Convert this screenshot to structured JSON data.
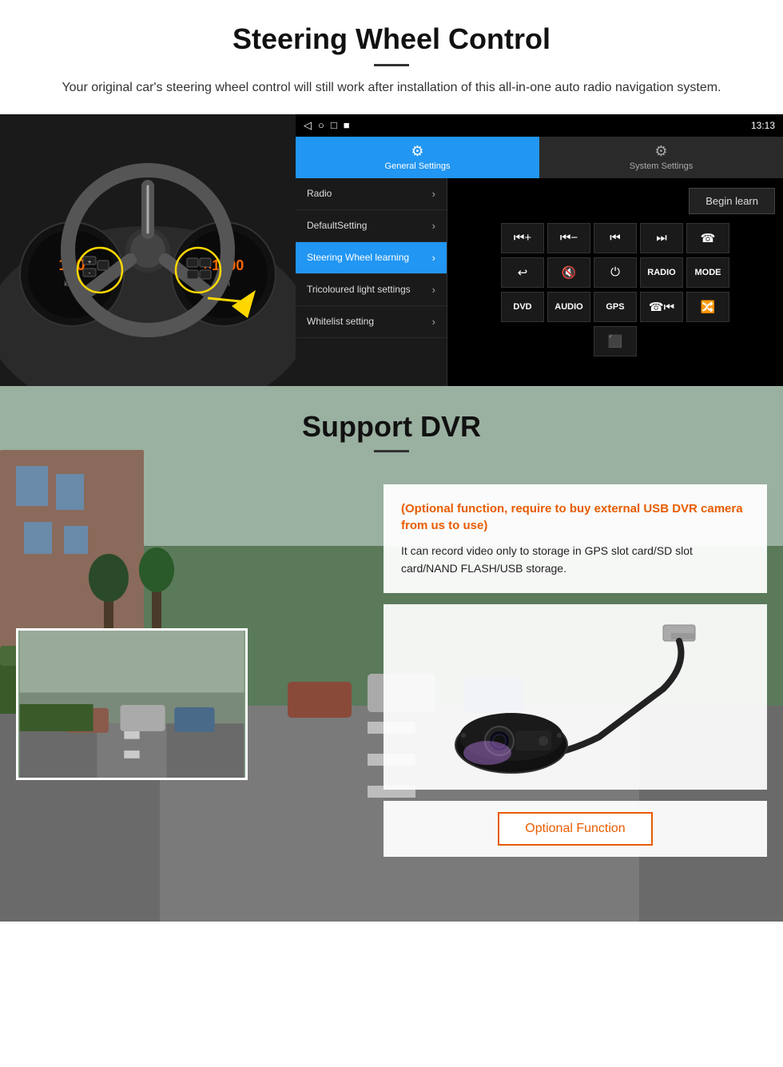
{
  "header": {
    "title": "Steering Wheel Control",
    "subtitle": "Your original car's steering wheel control will still work after installation of this all-in-one auto radio navigation system."
  },
  "android_ui": {
    "status_bar": {
      "time": "13:13",
      "icons": [
        "◁",
        "○",
        "□",
        "■"
      ]
    },
    "tabs": [
      {
        "label": "General Settings",
        "icon": "⚙",
        "active": true
      },
      {
        "label": "System Settings",
        "icon": "🔧",
        "active": false
      }
    ],
    "menu_items": [
      {
        "label": "Radio",
        "active": false
      },
      {
        "label": "DefaultSetting",
        "active": false
      },
      {
        "label": "Steering Wheel learning",
        "active": true
      },
      {
        "label": "Tricoloured light settings",
        "active": false
      },
      {
        "label": "Whitelist setting",
        "active": false
      }
    ],
    "begin_learn_label": "Begin learn",
    "control_rows": [
      [
        "⏮+",
        "⏮-",
        "⏮|",
        "|⏭",
        "☎"
      ],
      [
        "↩",
        "🔇×",
        "⏻",
        "RADIO",
        "MODE"
      ],
      [
        "DVD",
        "AUDIO",
        "GPS",
        "☎⏮|",
        "🔀⏭"
      ]
    ],
    "extra_btn": "⬛"
  },
  "dvr_section": {
    "title": "Support DVR",
    "optional_text": "(Optional function, require to buy external USB DVR camera from us to use)",
    "description": "It can record video only to storage in GPS slot card/SD slot card/NAND FLASH/USB storage.",
    "optional_function_label": "Optional Function"
  }
}
